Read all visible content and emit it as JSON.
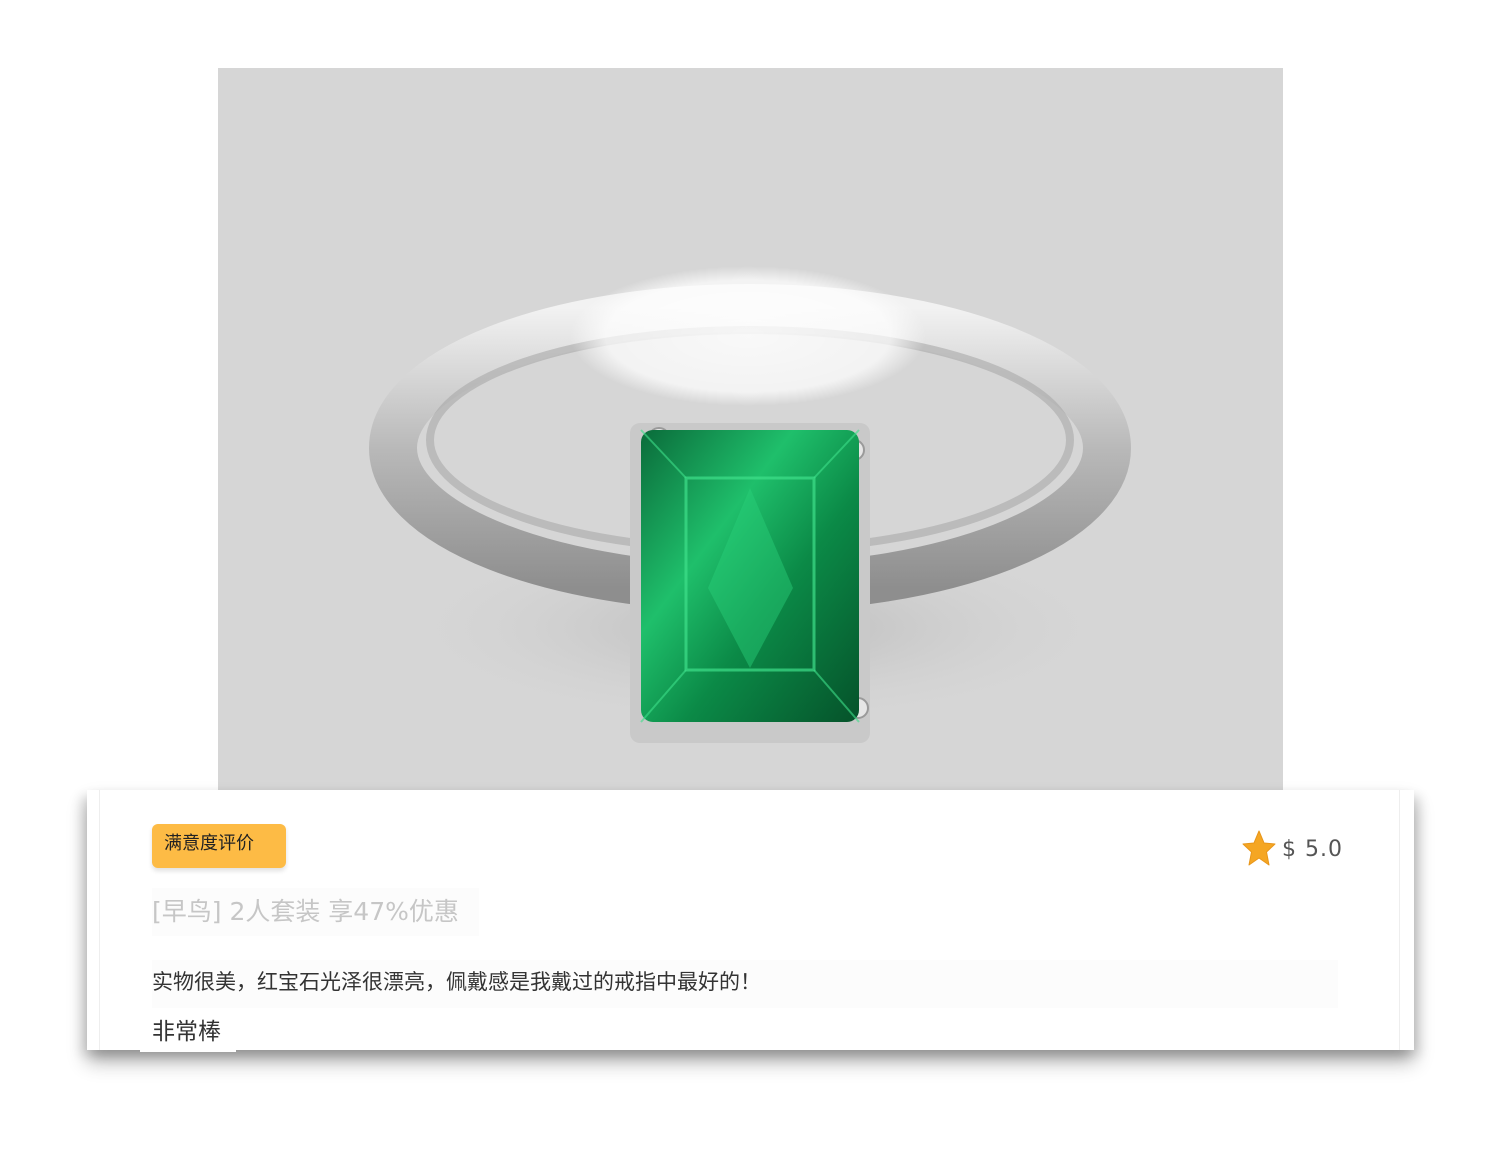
{
  "product": {
    "image_alt": "emerald-cut green gemstone solitaire ring"
  },
  "review": {
    "badge_label": "满意度评价",
    "price": "$ 5.0",
    "promo_text": "[早鸟] 2人套装 享47%优惠",
    "review_text": "实物很美，红宝石光泽很漂亮，佩戴感是我戴过的戒指中最好的！",
    "summary_text": "非常棒"
  },
  "icons": {
    "rating": "star-icon"
  },
  "colors": {
    "badge": "#fdbb45",
    "star": "#f5a623",
    "photo_background": "#d6d6d6",
    "gem": "#0e8f4f"
  }
}
